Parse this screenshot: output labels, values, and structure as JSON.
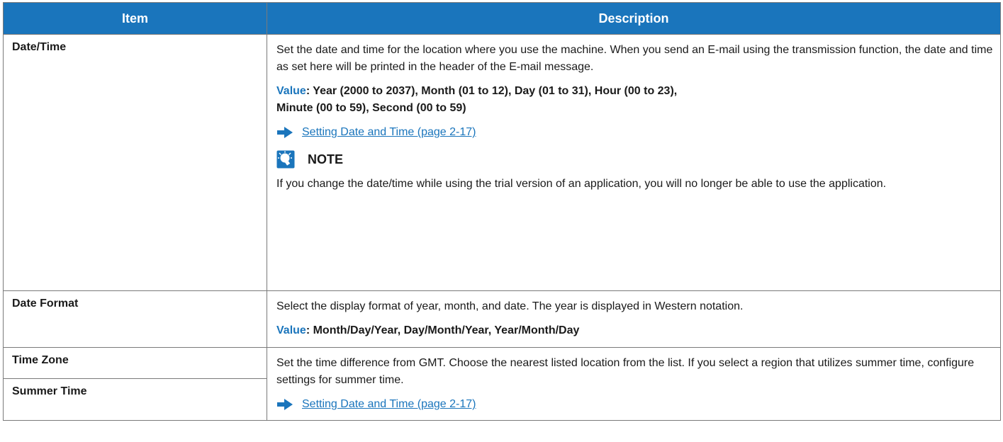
{
  "table": {
    "headers": {
      "item": "Item",
      "description": "Description"
    },
    "rows": [
      {
        "item": "Date/Time",
        "desc": "Set the date and time for the location where you use the machine. When you send an E-mail using the transmission function, the date and time as set here will be printed in the header of the E-mail message.",
        "value_label": "Value",
        "value_text_line1": ": Year (2000 to 2037), Month (01 to 12), Day (01 to 31), Hour (00 to 23),",
        "value_text_line2": "Minute (00 to 59), Second (00 to 59)",
        "link": "Setting Date and Time (page 2-17)",
        "note_title": "NOTE",
        "note_text": "If you change the date/time while using the trial version of an application, you will no longer be able to use the application."
      },
      {
        "item": "Date Format",
        "desc": "Select the display format of year, month, and date. The year is displayed in Western notation.",
        "value_label": "Value",
        "value_text": ": Month/Day/Year, Day/Month/Year, Year/Month/Day"
      },
      {
        "item": "Time Zone",
        "item2": "Summer Time",
        "desc": "Set the time difference from GMT. Choose the nearest listed location from the list. If you select a region that utilizes summer time, configure settings for summer time.",
        "link": "Setting Date and Time (page 2-17)"
      }
    ]
  },
  "icons": {
    "arrow": "arrow-right-icon",
    "note": "note-lightbulb-icon"
  },
  "colors": {
    "accent": "#1a75bc",
    "header_text": "#ffffff",
    "border": "#7a7a7a"
  }
}
